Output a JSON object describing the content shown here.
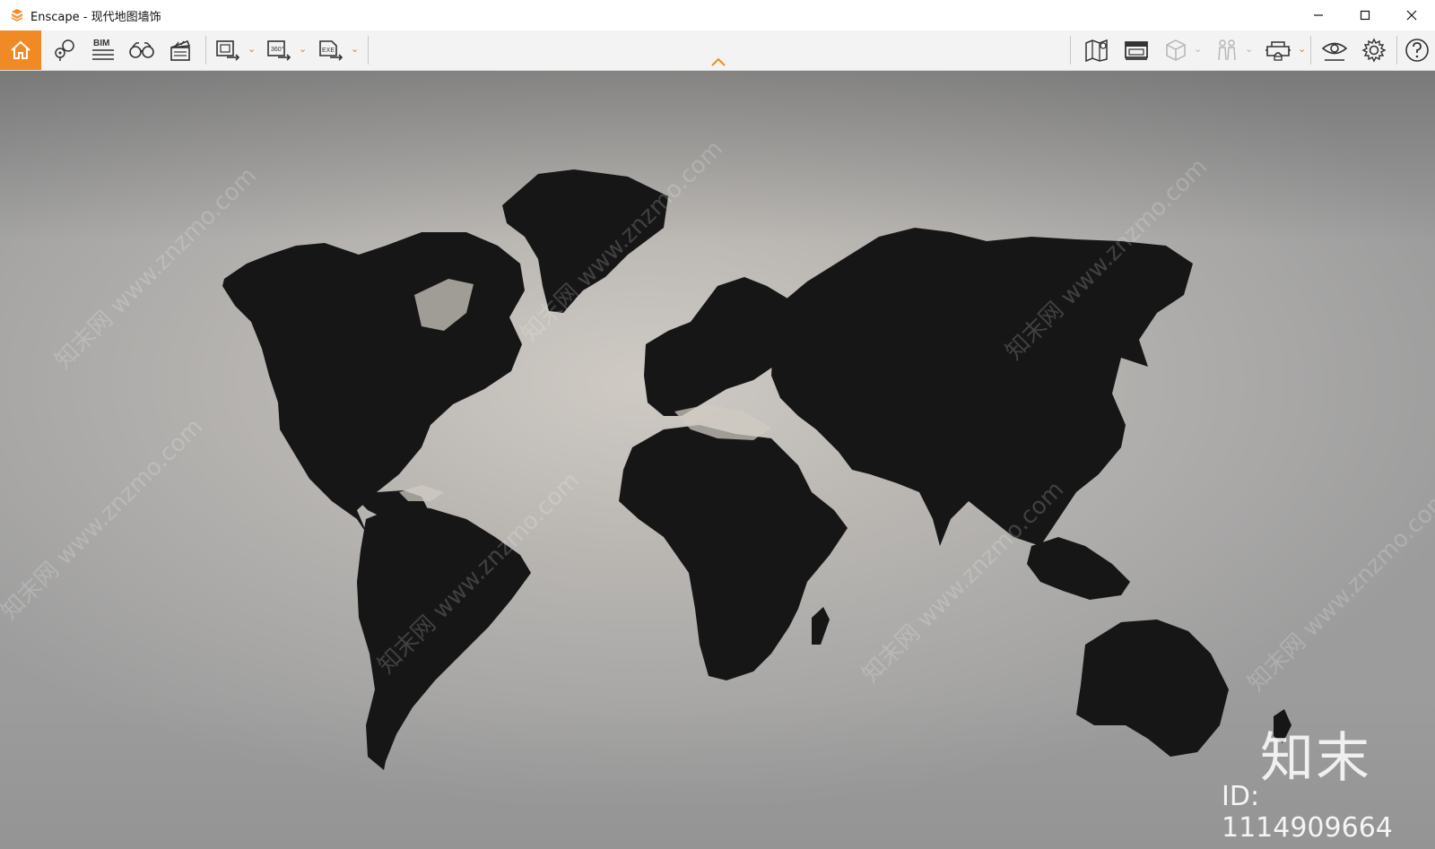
{
  "window": {
    "app_name": "Enscape",
    "separator": "-",
    "document_name": "现代地图墙饰",
    "controls": [
      "minimize",
      "maximize",
      "close"
    ]
  },
  "toolbar": {
    "left_tools": [
      {
        "name": "home-icon",
        "active": true
      },
      {
        "name": "views-location-icon"
      },
      {
        "name": "bim-icon",
        "label": "BIM"
      },
      {
        "name": "binoculars-icon"
      },
      {
        "name": "clapperboard-icon"
      },
      {
        "name": "export-render-icon",
        "dropdown": true
      },
      {
        "name": "export-panorama-icon",
        "label": "360°",
        "dropdown": true
      },
      {
        "name": "export-exe-icon",
        "label": "EXE",
        "dropdown": true
      }
    ],
    "right_tools": [
      {
        "name": "map-icon"
      },
      {
        "name": "monitor-icon"
      },
      {
        "name": "cube-icon",
        "dropdown": true,
        "disabled": true
      },
      {
        "name": "people-icon",
        "dropdown": true,
        "disabled": true
      },
      {
        "name": "vr-headset-icon",
        "dropdown": true
      },
      {
        "name": "eye-icon"
      },
      {
        "name": "gear-icon"
      },
      {
        "name": "help-icon"
      }
    ],
    "accent_color": "#f08a24"
  },
  "viewport": {
    "watermark_text": "知末网 www.znzmo.com",
    "brand_mark": "知末",
    "id_label": "ID: 1114909664",
    "map_color": "#161616"
  }
}
